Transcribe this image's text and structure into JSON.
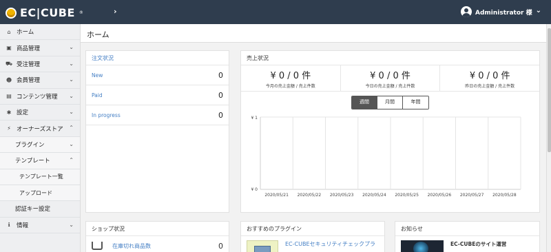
{
  "header": {
    "logo_text": "EC|CUBE",
    "logo_tm": "®",
    "menu_toggle_glyph": "›",
    "user_name": "Administrator 様",
    "user_chevron": "⌄"
  },
  "sidebar": {
    "items": [
      {
        "label": "ホーム",
        "icon": "home-icon",
        "glyph": "⌂",
        "chevron": ""
      },
      {
        "label": "商品管理",
        "icon": "cube-icon",
        "glyph": "▣",
        "chevron": "⌄"
      },
      {
        "label": "受注管理",
        "icon": "cart-icon",
        "glyph": "⛟",
        "chevron": "⌄"
      },
      {
        "label": "会員管理",
        "icon": "users-icon",
        "glyph": "☻",
        "chevron": "⌄"
      },
      {
        "label": "コンテンツ管理",
        "icon": "file-icon",
        "glyph": "▤",
        "chevron": "⌄"
      },
      {
        "label": "設定",
        "icon": "gear-icon",
        "glyph": "✱",
        "chevron": "⌄"
      },
      {
        "label": "オーナーズストア",
        "icon": "plug-icon",
        "glyph": "⚡",
        "chevron": "⌃"
      },
      {
        "label": "プラグイン",
        "chevron": "⌄"
      },
      {
        "label": "テンプレート",
        "chevron": "⌃"
      },
      {
        "label": "テンプレート一覧"
      },
      {
        "label": "アップロード"
      },
      {
        "label": "認証キー設定"
      },
      {
        "label": "情報",
        "icon": "info-icon",
        "glyph": "ℹ",
        "chevron": "⌄"
      }
    ]
  },
  "page": {
    "title": "ホーム"
  },
  "orders": {
    "title": "注文状況",
    "rows": [
      {
        "label": "New",
        "count": "0"
      },
      {
        "label": "Paid",
        "count": "0"
      },
      {
        "label": "In progress",
        "count": "0"
      }
    ]
  },
  "sales": {
    "title": "売上状況",
    "summary": [
      {
        "value": "¥ 0 / 0 件",
        "caption": "今月の売上金額 / 売上件数"
      },
      {
        "value": "¥ 0 / 0 件",
        "caption": "今日の売上金額 / 売上件数"
      },
      {
        "value": "¥ 0 / 0 件",
        "caption": "昨日の売上金額 / 売上件数"
      }
    ],
    "tabs": [
      {
        "label": "週間",
        "active": true
      },
      {
        "label": "月間",
        "active": false
      },
      {
        "label": "年間",
        "active": false
      }
    ]
  },
  "chart_data": {
    "type": "line",
    "categories": [
      "2020/05/21",
      "2020/05/22",
      "2020/05/23",
      "2020/05/24",
      "2020/05/25",
      "2020/05/26",
      "2020/05/27",
      "2020/05/28"
    ],
    "series": [
      {
        "values": [
          0,
          0,
          0,
          0,
          0,
          0,
          0,
          0
        ]
      }
    ],
    "y_ticks": [
      "¥ 1",
      "¥ 0"
    ],
    "ylim": [
      0,
      1
    ],
    "grid": true
  },
  "shop": {
    "title": "ショップ状況",
    "rows": [
      {
        "label": "在庫切れ商品数",
        "count": "0",
        "icon": "inbox-icon"
      }
    ]
  },
  "plugins": {
    "title": "おすすめのプラグイン",
    "items": [
      {
        "label": "EC-CUBEセキュリティチェックプラ"
      }
    ]
  },
  "news": {
    "title": "お知らせ",
    "items": [
      {
        "label": "EC-CUBEのサイト運営"
      }
    ]
  },
  "colors": {
    "topbar": "#2f3d4e",
    "link": "#437ec4",
    "active_tab": "#555555"
  }
}
